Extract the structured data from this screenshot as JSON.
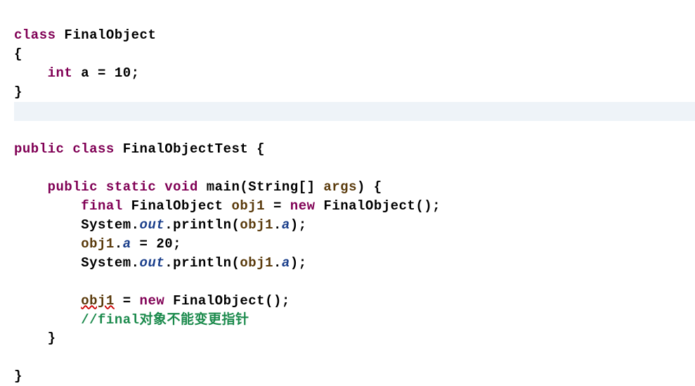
{
  "code": {
    "l1_class": "class",
    "l1_name": "FinalObject",
    "l2_brace": "{",
    "l3_type": "int",
    "l3_var": " a ",
    "l3_assign": "= ",
    "l3_val": "10",
    "l3_semi": ";",
    "l4_brace": "}",
    "l6_public": "public",
    "l6_class": "class",
    "l6_name": "FinalObjectTest {",
    "l8_psv": "public static void",
    "l8_main": " main(String[] ",
    "l8_args": "args",
    "l8_end": ") {",
    "l9_final": "final",
    "l9_type": " FinalObject ",
    "l9_obj": "obj1",
    "l9_eq": " = ",
    "l9_new": "new",
    "l9_ctor": " FinalObject();",
    "l10_sys": "System.",
    "l10_out": "out",
    "l10_print": ".println(",
    "l10_obj": "obj1",
    "l10_dot": ".",
    "l10_a": "a",
    "l10_end": ");",
    "l11_obj": "obj1",
    "l11_dot": ".",
    "l11_a": "a",
    "l11_eq": " = 20;",
    "l12_sys": "System.",
    "l12_out": "out",
    "l12_print": ".println(",
    "l12_obj": "obj1",
    "l12_dot": ".",
    "l12_a": "a",
    "l12_end": ");",
    "l14_obj": "obj1",
    "l14_eq": " = ",
    "l14_new": "new",
    "l14_ctor": " FinalObject();",
    "l15_comment": "//final对象不能变更指针",
    "l16_brace": "}",
    "l18_brace": "}"
  }
}
